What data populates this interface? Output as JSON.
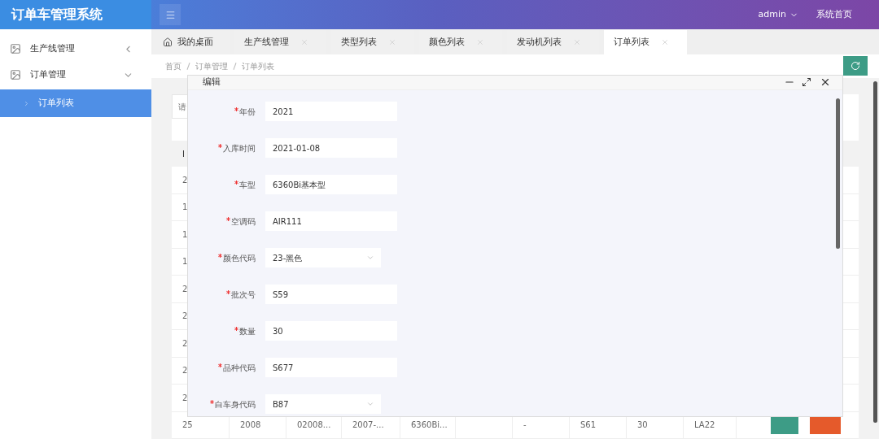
{
  "header": {
    "title": "订单车管理系统",
    "user": "admin",
    "home_link": "系统首页"
  },
  "sidebar": {
    "items": [
      {
        "label": "生产线管理",
        "expanded": false
      },
      {
        "label": "订单管理",
        "expanded": true,
        "children": [
          {
            "label": "订单列表",
            "selected": true
          }
        ]
      }
    ]
  },
  "tabs": [
    {
      "label": "我的桌面",
      "kind": "home",
      "selected": false
    },
    {
      "label": "生产线管理",
      "kind": "closable",
      "selected": false
    },
    {
      "label": "类型列表",
      "kind": "closable",
      "selected": false
    },
    {
      "label": "颜色列表",
      "kind": "closable",
      "selected": false
    },
    {
      "label": "发动机列表",
      "kind": "closable",
      "selected": false
    },
    {
      "label": "订单列表",
      "kind": "closable",
      "selected": true
    }
  ],
  "breadcrumb": [
    "首页",
    "订单管理",
    "订单列表"
  ],
  "background_page": {
    "search_placeholder": "请",
    "table": {
      "columns": [
        "I"
      ],
      "rows": [
        {
          "cells": [
            "2"
          ]
        },
        {
          "cells": [
            "1"
          ]
        },
        {
          "cells": [
            "1"
          ]
        },
        {
          "cells": [
            "1"
          ]
        },
        {
          "cells": [
            "2"
          ]
        },
        {
          "cells": [
            "2"
          ]
        },
        {
          "cells": [
            "2"
          ]
        },
        {
          "cells": [
            "2"
          ]
        },
        {
          "cells": [
            "2"
          ]
        },
        {
          "cells": [
            "25",
            "2008",
            "02008...",
            "2007-...",
            "6360Bi...",
            "",
            "-",
            "S61",
            "30",
            "LA22"
          ],
          "actions": true
        }
      ]
    }
  },
  "dialog": {
    "title": "编辑",
    "fields": [
      {
        "label": "年份",
        "kind": "text",
        "required": true,
        "value": "2021"
      },
      {
        "label": "入库时间",
        "kind": "text",
        "required": true,
        "value": "2021-01-08"
      },
      {
        "label": "车型",
        "kind": "text",
        "required": true,
        "value": "6360Bi基本型"
      },
      {
        "label": "空调码",
        "kind": "text",
        "required": true,
        "value": "AIR111"
      },
      {
        "label": "颜色代码",
        "kind": "select",
        "required": true,
        "value": "23-黑色"
      },
      {
        "label": "批次号",
        "kind": "text",
        "required": true,
        "value": "S59"
      },
      {
        "label": "数量",
        "kind": "text",
        "required": true,
        "value": "30"
      },
      {
        "label": "品种代码",
        "kind": "text",
        "required": true,
        "value": "S677"
      },
      {
        "label": "白车身代码",
        "kind": "select",
        "required": true,
        "value": "B87"
      }
    ]
  }
}
